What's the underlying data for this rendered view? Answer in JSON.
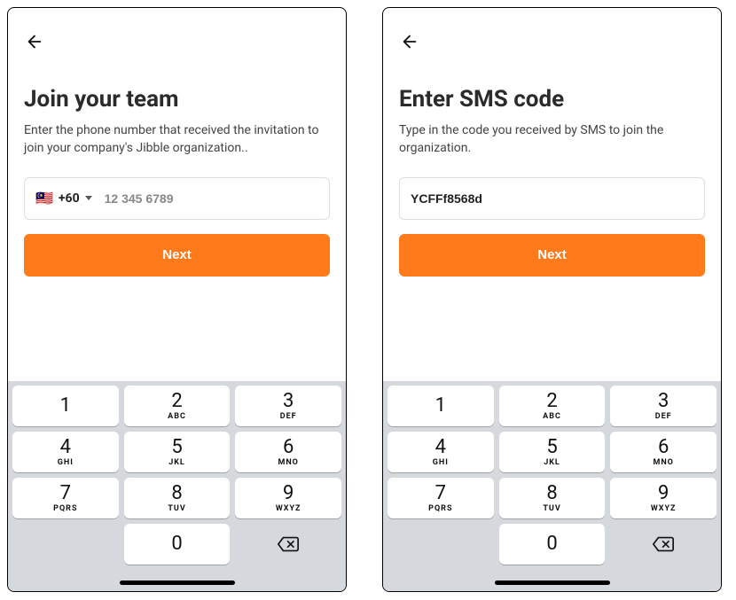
{
  "accent_color": "#ff7a1a",
  "screens": {
    "join_team": {
      "title": "Join your team",
      "subtitle": "Enter the phone number that received the invitation to join your company's Jibble organization..",
      "country_flag": "🇲🇾",
      "country_prefix": "+60",
      "phone_placeholder": "12 345 6789",
      "phone_value": "",
      "next_label": "Next"
    },
    "enter_sms": {
      "title": "Enter SMS code",
      "subtitle": "Type in the code you received by SMS to join the organization.",
      "code_value": "YCFFf8568d",
      "next_label": "Next"
    }
  },
  "keypad": {
    "keys": [
      {
        "num": "1",
        "letters": ""
      },
      {
        "num": "2",
        "letters": "ABC"
      },
      {
        "num": "3",
        "letters": "DEF"
      },
      {
        "num": "4",
        "letters": "GHI"
      },
      {
        "num": "5",
        "letters": "JKL"
      },
      {
        "num": "6",
        "letters": "MNO"
      },
      {
        "num": "7",
        "letters": "PQRS"
      },
      {
        "num": "8",
        "letters": "TUV"
      },
      {
        "num": "9",
        "letters": "WXYZ"
      }
    ],
    "zero": "0"
  }
}
